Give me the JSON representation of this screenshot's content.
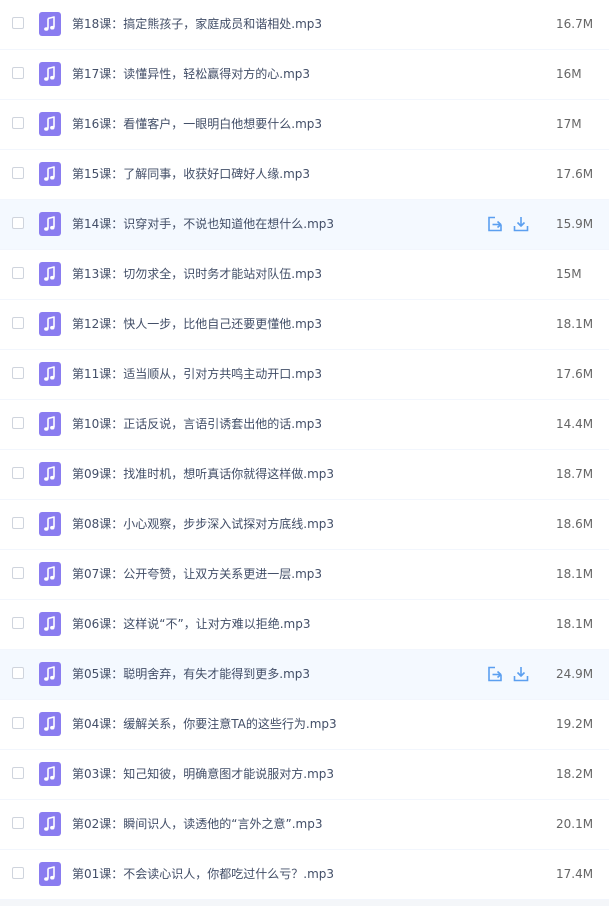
{
  "colors": {
    "icon_purple": "#8a7cf0",
    "action_blue": "#5b9ff0",
    "hover_row": "#f4f9ff"
  },
  "icons": {
    "file_type": "music-note-icon",
    "share": "share-icon",
    "download": "download-icon"
  },
  "files": [
    {
      "name": "第18课：搞定熊孩子，家庭成员和谐相处.mp3",
      "size": "16.7M",
      "hover": false
    },
    {
      "name": "第17课：读懂异性，轻松赢得对方的心.mp3",
      "size": "16M",
      "hover": false
    },
    {
      "name": "第16课：看懂客户，一眼明白他想要什么.mp3",
      "size": "17M",
      "hover": false
    },
    {
      "name": "第15课：了解同事，收获好口碑好人缘.mp3",
      "size": "17.6M",
      "hover": false
    },
    {
      "name": "第14课：识穿对手，不说也知道他在想什么.mp3",
      "size": "15.9M",
      "hover": true
    },
    {
      "name": "第13课：切勿求全，识时务才能站对队伍.mp3",
      "size": "15M",
      "hover": false
    },
    {
      "name": "第12课：快人一步，比他自己还要更懂他.mp3",
      "size": "18.1M",
      "hover": false
    },
    {
      "name": "第11课：适当顺从，引对方共鸣主动开口.mp3",
      "size": "17.6M",
      "hover": false
    },
    {
      "name": "第10课：正话反说，言语引诱套出他的话.mp3",
      "size": "14.4M",
      "hover": false
    },
    {
      "name": "第09课：找准时机，想听真话你就得这样做.mp3",
      "size": "18.7M",
      "hover": false
    },
    {
      "name": "第08课：小心观察，步步深入试探对方底线.mp3",
      "size": "18.6M",
      "hover": false
    },
    {
      "name": "第07课：公开夸赞，让双方关系更进一层.mp3",
      "size": "18.1M",
      "hover": false
    },
    {
      "name": "第06课：这样说“不”，让对方难以拒绝.mp3",
      "size": "18.1M",
      "hover": false
    },
    {
      "name": "第05课：聪明舍弃，有失才能得到更多.mp3",
      "size": "24.9M",
      "hover": true
    },
    {
      "name": "第04课：缓解关系，你要注意TA的这些行为.mp3",
      "size": "19.2M",
      "hover": false
    },
    {
      "name": "第03课：知己知彼，明确意图才能说服对方.mp3",
      "size": "18.2M",
      "hover": false
    },
    {
      "name": "第02课：瞬间识人，读透他的“言外之意”.mp3",
      "size": "20.1M",
      "hover": false
    },
    {
      "name": "第01课：不会读心识人，你都吃过什么亏？.mp3",
      "size": "17.4M",
      "hover": false
    }
  ]
}
